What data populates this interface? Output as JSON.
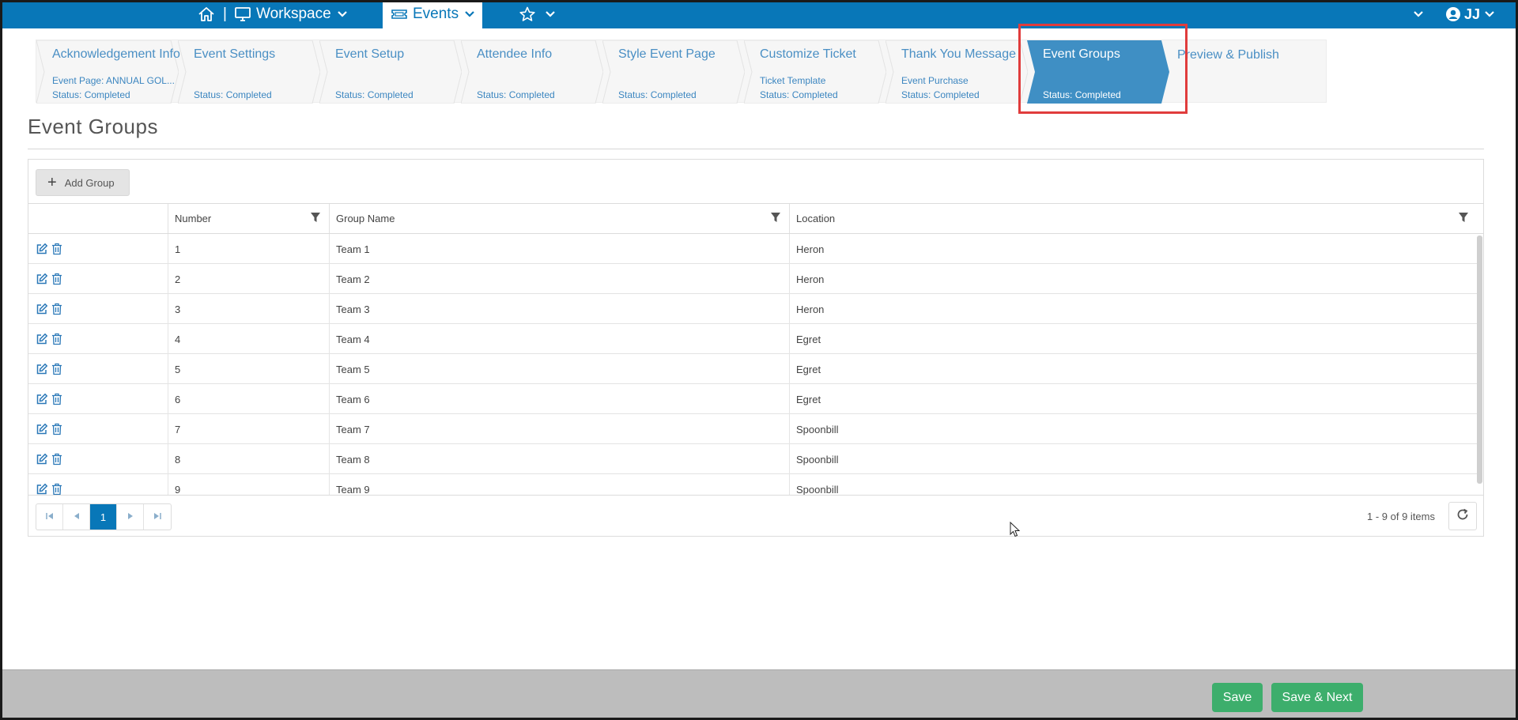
{
  "topbar": {
    "workspace_label": "Workspace",
    "events_label": "Events",
    "separator": "|",
    "user_initials": "JJ",
    "icons": [
      "home-icon",
      "monitor-icon",
      "ticket-icon",
      "star-icon",
      "chevron-down-icon",
      "user-circle-icon"
    ],
    "bar_color": "#0877b8"
  },
  "wizard": {
    "steps": [
      {
        "title": "Acknowledgement Info",
        "sub": "Event Page: ANNUAL GOL...",
        "status": "Status: Completed"
      },
      {
        "title": "Event Settings",
        "sub": "",
        "status": "Status: Completed"
      },
      {
        "title": "Event Setup",
        "sub": "",
        "status": "Status: Completed"
      },
      {
        "title": "Attendee Info",
        "sub": "",
        "status": "Status: Completed"
      },
      {
        "title": "Style Event Page",
        "sub": "",
        "status": "Status: Completed"
      },
      {
        "title": "Customize Ticket",
        "sub": "Ticket Template",
        "status": "Status: Completed"
      },
      {
        "title": "Thank You Message",
        "sub": "Event Purchase",
        "status": "Status: Completed"
      },
      {
        "title": "Event Groups",
        "sub": "",
        "status": "Status: Completed"
      },
      {
        "title": "Preview & Publish",
        "sub": "",
        "status": ""
      }
    ],
    "active_index": 7,
    "active_color": "#3f8fc4",
    "highlight_color": "#e03c3c"
  },
  "page": {
    "title": "Event Groups"
  },
  "grid": {
    "add_label": "Add Group",
    "columns": [
      "Number",
      "Group Name",
      "Location"
    ],
    "rows": [
      {
        "number": "1",
        "name": "Team 1",
        "location": "Heron"
      },
      {
        "number": "2",
        "name": "Team 2",
        "location": "Heron"
      },
      {
        "number": "3",
        "name": "Team 3",
        "location": "Heron"
      },
      {
        "number": "4",
        "name": "Team 4",
        "location": "Egret"
      },
      {
        "number": "5",
        "name": "Team 5",
        "location": "Egret"
      },
      {
        "number": "6",
        "name": "Team 6",
        "location": "Egret"
      },
      {
        "number": "7",
        "name": "Team 7",
        "location": "Spoonbill"
      },
      {
        "number": "8",
        "name": "Team 8",
        "location": "Spoonbill"
      },
      {
        "number": "9",
        "name": "Team 9",
        "location": "Spoonbill"
      }
    ],
    "current_page": "1",
    "items_text": "1 - 9 of 9 items",
    "row_icons": [
      "edit-icon",
      "trash-icon"
    ]
  },
  "footer": {
    "save_label": "Save",
    "save_next_label": "Save & Next",
    "button_color": "#3dae6c"
  }
}
